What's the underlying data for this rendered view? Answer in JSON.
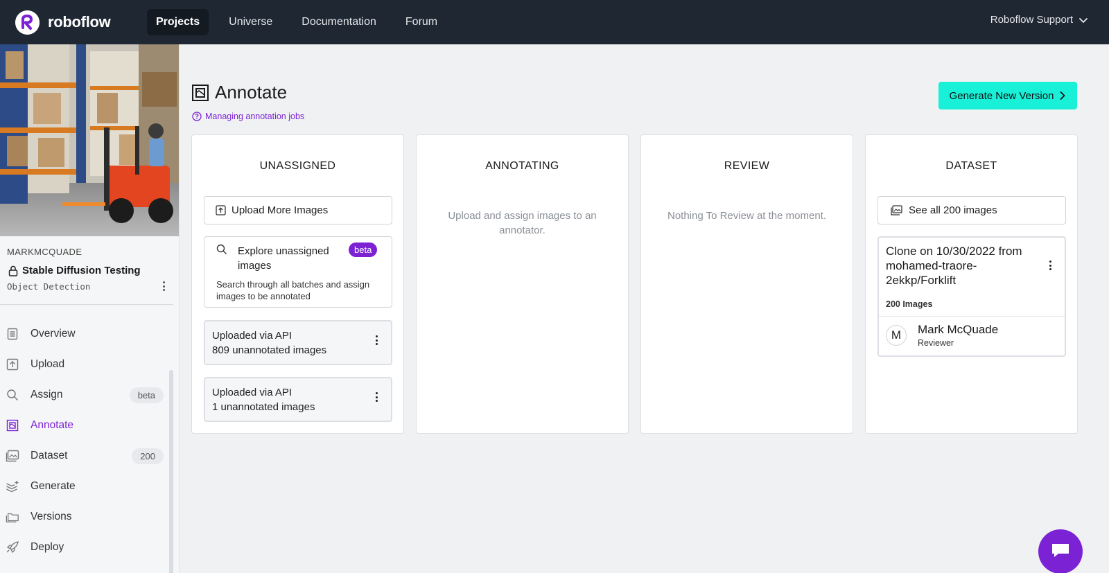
{
  "nav": {
    "brand": "roboflow",
    "links": [
      {
        "label": "Projects",
        "active": true
      },
      {
        "label": "Universe",
        "active": false
      },
      {
        "label": "Documentation",
        "active": false
      },
      {
        "label": "Forum",
        "active": false
      }
    ],
    "user": "Roboflow Support"
  },
  "sidebar": {
    "owner": "MARKMCQUADE",
    "project_name": "Stable Diffusion Testing",
    "project_type": "Object Detection",
    "items": [
      {
        "label": "Overview",
        "icon": "document-icon",
        "badge": ""
      },
      {
        "label": "Upload",
        "icon": "upload-icon",
        "badge": ""
      },
      {
        "label": "Assign",
        "icon": "search-icon",
        "badge": "beta"
      },
      {
        "label": "Annotate",
        "icon": "annotate-icon",
        "badge": "",
        "active": true
      },
      {
        "label": "Dataset",
        "icon": "images-icon",
        "badge": "200"
      },
      {
        "label": "Generate",
        "icon": "layers-plus-icon",
        "badge": ""
      },
      {
        "label": "Versions",
        "icon": "folders-icon",
        "badge": ""
      },
      {
        "label": "Deploy",
        "icon": "rocket-icon",
        "badge": ""
      }
    ]
  },
  "header": {
    "title": "Annotate",
    "help_link": "Managing annotation jobs",
    "generate_button": "Generate New Version"
  },
  "columns": {
    "unassigned": {
      "title": "UNASSIGNED",
      "upload_button": "Upload More Images",
      "explore_title": "Explore unassigned images",
      "explore_badge": "beta",
      "explore_desc": "Search through all batches and assign images to be annotated",
      "batches": [
        {
          "source": "Uploaded via API",
          "count": "809 unannotated images"
        },
        {
          "source": "Uploaded via API",
          "count": "1 unannotated images"
        }
      ]
    },
    "annotating": {
      "title": "ANNOTATING",
      "empty": "Upload and assign images to an annotator."
    },
    "review": {
      "title": "REVIEW",
      "empty": "Nothing To Review at the moment."
    },
    "dataset": {
      "title": "DATASET",
      "see_all": "See all 200 images",
      "version_title": "Clone on 10/30/2022 from mohamed-traore-2ekkp/Forklift",
      "version_count": "200 Images",
      "reviewer_initial": "M",
      "reviewer_name": "Mark McQuade",
      "reviewer_role": "Reviewer"
    }
  },
  "colors": {
    "nav_bg": "#1f2733",
    "accent": "#7b22d4",
    "primary_button": "#18f0d8"
  }
}
